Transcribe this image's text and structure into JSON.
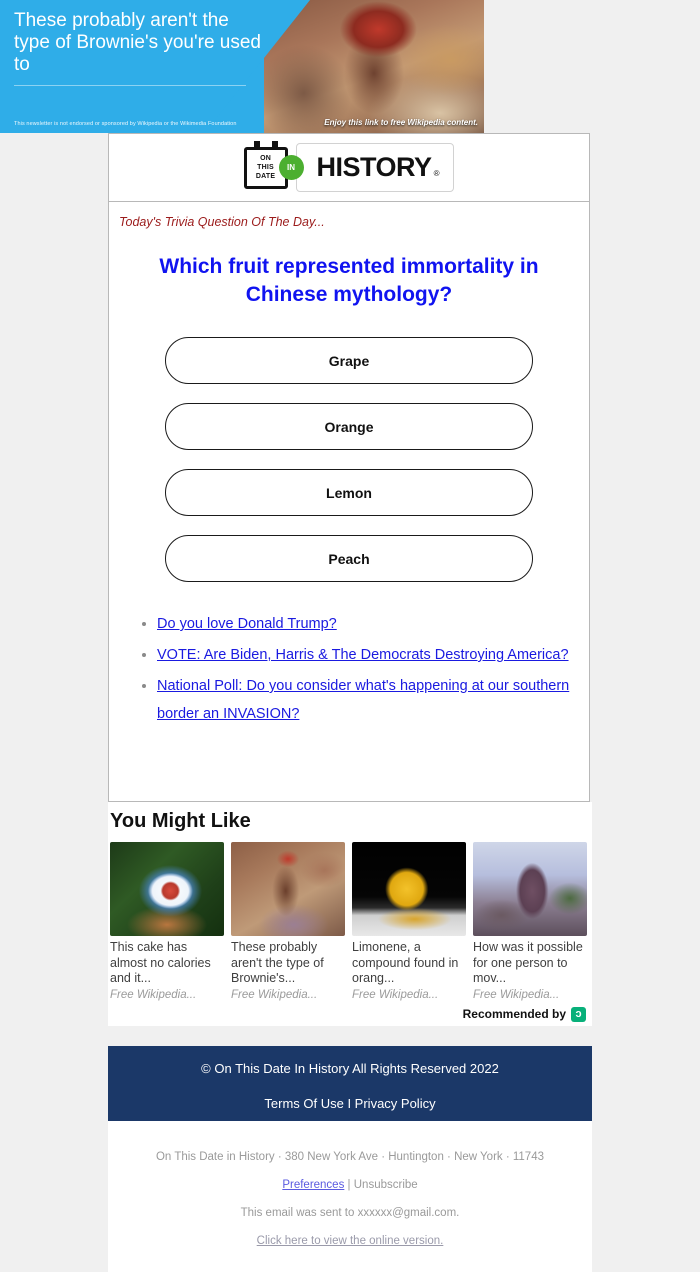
{
  "banner": {
    "headline": "These probably aren't the type of Brownie's you're used to",
    "disclaimer": "This newsletter is not endorsed or sponsored by Wikipedia or the Wikimedia Foundation",
    "cta": "Enjoy this link to free Wikipedia content.",
    "blue": "#2fade8"
  },
  "logo": {
    "line1": "ON",
    "line2": "THIS",
    "line3": "DATE",
    "in": "IN",
    "word": "HISTORY",
    "registered": "®",
    "green": "#4caf30"
  },
  "trivia": {
    "label": "Today's Trivia Question Of The Day...",
    "question": "Which fruit represented immortality in Chinese mythology?",
    "question_color": "#1013f0",
    "label_color": "#9b1b1b",
    "answers": [
      {
        "label": "Grape"
      },
      {
        "label": "Orange"
      },
      {
        "label": "Lemon"
      },
      {
        "label": "Peach"
      }
    ]
  },
  "polls": [
    {
      "text": "Do you love Donald Trump?"
    },
    {
      "text": "VOTE: Are Biden, Harris & The Democrats Destroying America?"
    },
    {
      "text": "National Poll: Do you consider what's happening at our southern border an INVASION?"
    }
  ],
  "you_might_like": {
    "title": "You Might Like",
    "cards": [
      {
        "title": "This cake has almost no calories and it...",
        "source": "Free Wikipedia..."
      },
      {
        "title": "These probably aren't the type of Brownie's...",
        "source": "Free Wikipedia..."
      },
      {
        "title": "Limonene, a compound found in orang...",
        "source": "Free Wikipedia..."
      },
      {
        "title": "How was it possible for one person to mov...",
        "source": "Free Wikipedia..."
      }
    ],
    "recommended_by": "Recommended by",
    "provider_glyph": "ɔ",
    "provider_color": "#08b07a"
  },
  "footer": {
    "copyright": "© On This Date In History All Rights Reserved 2022",
    "terms": "Terms Of Use I Privacy Policy",
    "background": "#1b3868"
  },
  "legal": {
    "address": "On This Date in History · 380 New York Ave · Huntington · New York · 11743",
    "preferences": "Preferences",
    "separator": "|",
    "unsubscribe": "Unsubscribe",
    "sent_to": "This email was sent to xxxxxx@gmail.com.",
    "online_version": "Click here to view the online version."
  }
}
